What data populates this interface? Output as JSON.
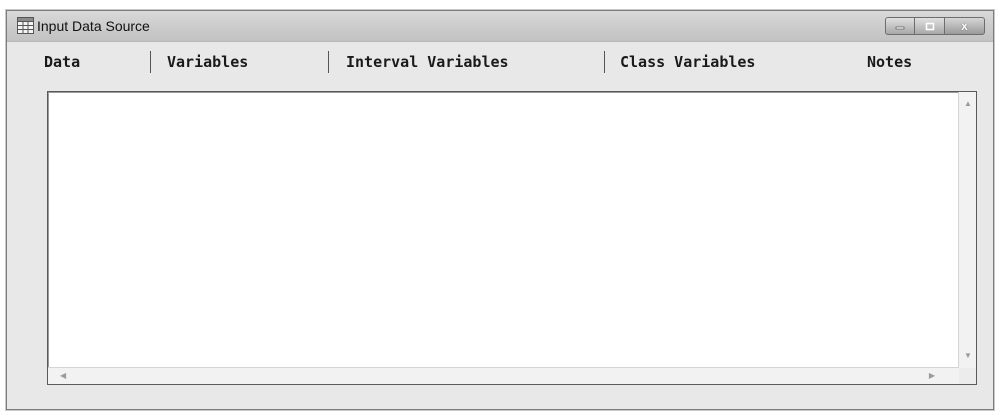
{
  "window": {
    "title": "Input Data Source",
    "controls": {
      "minimize_icon": "minimize-icon",
      "maximize_icon": "maximize-icon",
      "close_icon": "close-icon",
      "close_glyph": "x"
    }
  },
  "tabs": [
    {
      "label": "Data"
    },
    {
      "label": "Variables"
    },
    {
      "label": "Interval Variables"
    },
    {
      "label": "Class Variables"
    },
    {
      "label": "Notes"
    }
  ],
  "colors": {
    "titlebar": "#cbcbcb",
    "window_bg": "#e8e8e8",
    "content_bg": "#ffffff"
  }
}
